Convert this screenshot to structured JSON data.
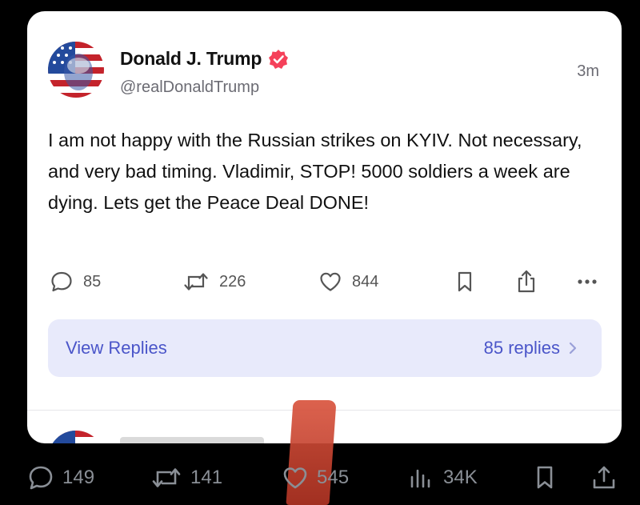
{
  "post": {
    "author_name": "Donald J. Trump",
    "handle": "@realDonaldTrump",
    "timestamp": "3m",
    "text": "I am not happy with the Russian strikes on KYIV. Not necessary, and very bad timing. Vladimir, STOP! 5000 soldiers a week are dying. Lets get the Peace Deal DONE!",
    "actions": {
      "replies": "85",
      "reposts": "226",
      "likes": "844"
    },
    "view_replies_label": "View Replies",
    "replies_count_label": "85 replies"
  },
  "outer_bar": {
    "comments": "149",
    "retweets": "141",
    "likes": "545",
    "views": "34K"
  },
  "colors": {
    "verified_badge": "#f5415a",
    "replies_button_bg": "#e8eafb",
    "replies_text": "#4a55c9",
    "page_bg": "#000000"
  }
}
